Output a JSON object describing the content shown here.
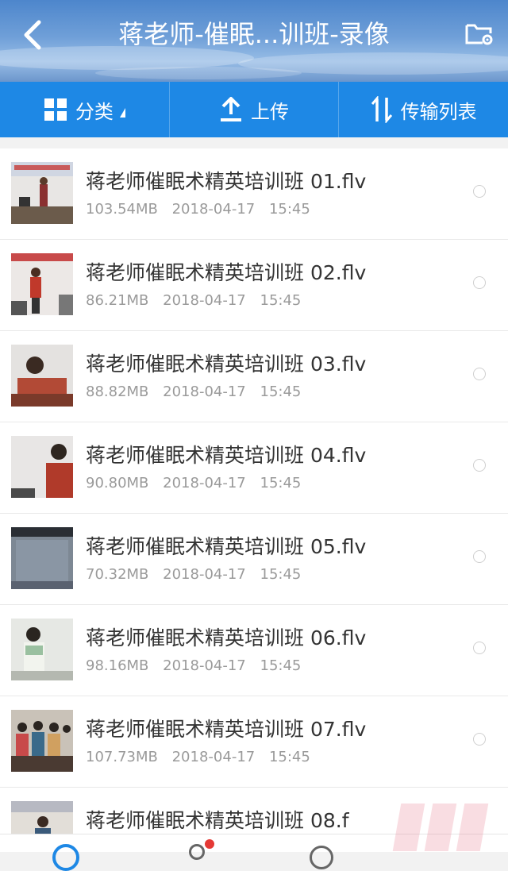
{
  "header": {
    "title": "蒋老师-催眠...训班-录像",
    "back_icon": "back-chevron-icon",
    "folder_icon": "folder-settings-icon"
  },
  "toolbar": {
    "category_label": "分类",
    "upload_label": "上传",
    "transfer_label": "传输列表",
    "accent_color": "#1e88e5"
  },
  "files": [
    {
      "name": "蒋老师催眠术精英培训班 01.flv",
      "size": "103.54MB",
      "date": "2018-04-17",
      "time": "15:45"
    },
    {
      "name": "蒋老师催眠术精英培训班 02.flv",
      "size": "86.21MB",
      "date": "2018-04-17",
      "time": "15:45"
    },
    {
      "name": "蒋老师催眠术精英培训班 03.flv",
      "size": "88.82MB",
      "date": "2018-04-17",
      "time": "15:45"
    },
    {
      "name": "蒋老师催眠术精英培训班 04.flv",
      "size": "90.80MB",
      "date": "2018-04-17",
      "time": "15:45"
    },
    {
      "name": "蒋老师催眠术精英培训班 05.flv",
      "size": "70.32MB",
      "date": "2018-04-17",
      "time": "15:45"
    },
    {
      "name": "蒋老师催眠术精英培训班 06.flv",
      "size": "98.16MB",
      "date": "2018-04-17",
      "time": "15:45"
    },
    {
      "name": "蒋老师催眠术精英培训班 07.flv",
      "size": "107.73MB",
      "date": "2018-04-17",
      "time": "15:45"
    },
    {
      "name": "蒋老师催眠术精英培训班 08.f",
      "size": "",
      "date": "",
      "time": ""
    }
  ]
}
